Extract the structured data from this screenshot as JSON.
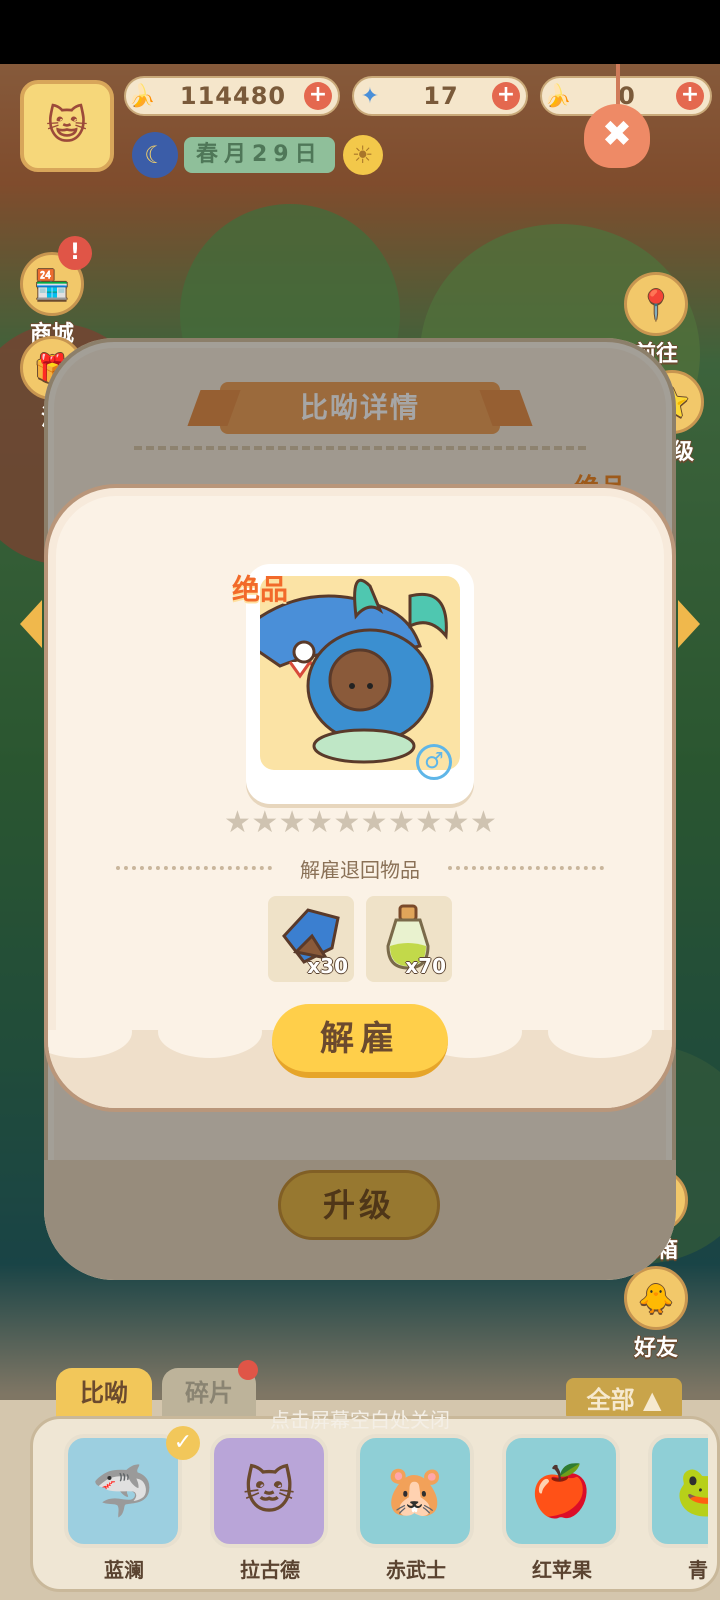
{
  "hud": {
    "bananas": "114480",
    "gems": "17",
    "tickets": "0",
    "date": "春月29日"
  },
  "side_buttons": {
    "shop": "商城",
    "activity": "活",
    "go": "前往",
    "level": "等级",
    "mail": "邮箱",
    "friends": "好友"
  },
  "back_panel": {
    "title": "比呦详情",
    "rarity": "绝品",
    "upgrade_label": "升级"
  },
  "dialog": {
    "rarity": "绝品",
    "stars_total": 10,
    "stars_filled": 0,
    "refund_label": "解雇退回物品",
    "items": [
      {
        "name": "shard-item",
        "qty": "x30"
      },
      {
        "name": "potion-item",
        "qty": "x70"
      }
    ],
    "fire_label": "解雇"
  },
  "bottom": {
    "tabs": [
      "比呦",
      "碎片"
    ],
    "filter": "全部",
    "hint": "点击屏幕空白处关闭",
    "roster": [
      "蓝澜",
      "拉古德",
      "赤武士",
      "红苹果",
      "青"
    ]
  }
}
